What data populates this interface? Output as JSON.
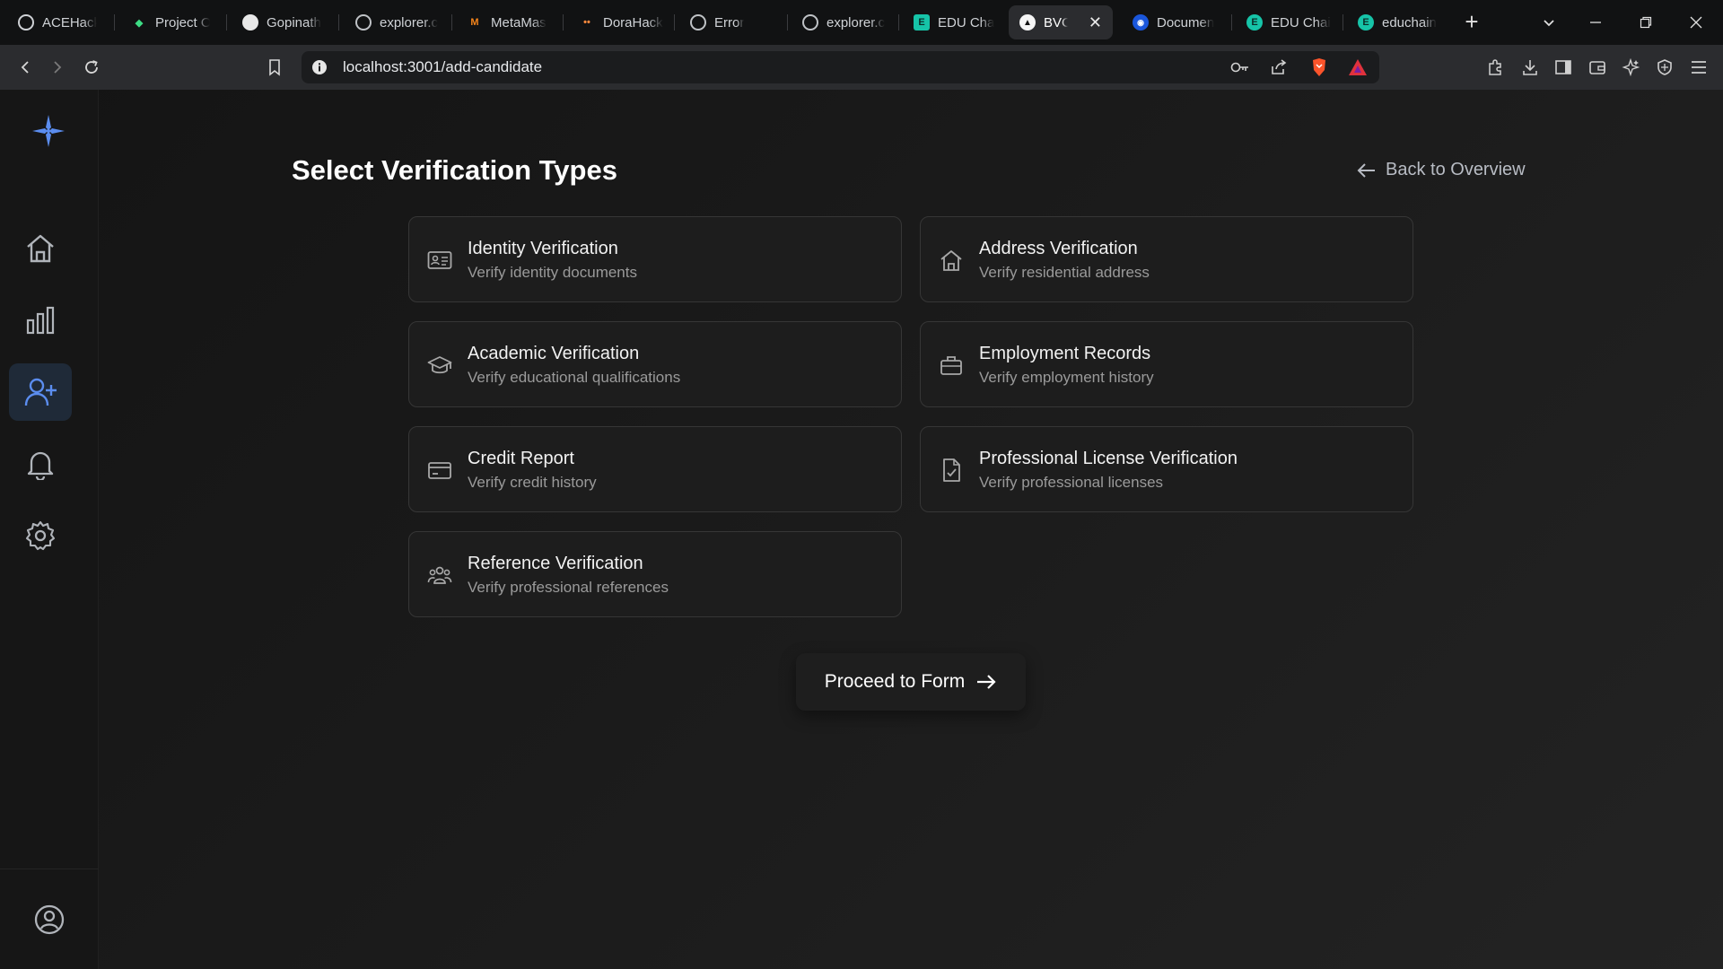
{
  "browser": {
    "tabs": [
      {
        "label": "ACEHack",
        "favicon": "circle-logo-icon"
      },
      {
        "label": "Project O",
        "favicon": "leaf-icon"
      },
      {
        "label": "Gopinath",
        "favicon": "github-icon"
      },
      {
        "label": "explorer.c",
        "favicon": "globe-icon"
      },
      {
        "label": "MetaMas",
        "favicon": "metamask-icon"
      },
      {
        "label": "DoraHack",
        "favicon": "dorahacks-icon"
      },
      {
        "label": "Error",
        "favicon": "globe-icon"
      },
      {
        "label": "explorer.c",
        "favicon": "globe-icon"
      },
      {
        "label": "EDU Cha",
        "favicon": "edu-icon"
      },
      {
        "label": "BVC",
        "favicon": "triangle-icon"
      },
      {
        "label": "Documen",
        "favicon": "doc-icon"
      },
      {
        "label": "EDU Chai",
        "favicon": "edu-circle-icon"
      },
      {
        "label": "educhain",
        "favicon": "edu-circle-icon"
      }
    ],
    "active_tab_index": 9,
    "url": "localhost:3001/add-candidate",
    "colors": {
      "brave": "#fb542b",
      "alert": "#e0323d",
      "accent": "#5b8def"
    }
  },
  "sidebar": {
    "items": [
      {
        "name": "home",
        "icon": "home-icon"
      },
      {
        "name": "analytics",
        "icon": "bar-chart-icon"
      },
      {
        "name": "add-candidate",
        "icon": "user-plus-icon",
        "active": true
      },
      {
        "name": "notifications",
        "icon": "bell-icon"
      },
      {
        "name": "settings",
        "icon": "gear-icon"
      }
    ],
    "profile_icon": "user-circle-icon",
    "logo_icon": "sparkle-logo-icon"
  },
  "main": {
    "title": "Select Verification Types",
    "back_label": "Back to Overview",
    "cards": [
      {
        "title": "Identity Verification",
        "subtitle": "Verify identity documents",
        "icon": "id-card-icon"
      },
      {
        "title": "Address Verification",
        "subtitle": "Verify residential address",
        "icon": "house-icon"
      },
      {
        "title": "Academic Verification",
        "subtitle": "Verify educational qualifications",
        "icon": "graduation-cap-icon"
      },
      {
        "title": "Employment Records",
        "subtitle": "Verify employment history",
        "icon": "briefcase-icon"
      },
      {
        "title": "Credit Report",
        "subtitle": "Verify credit history",
        "icon": "credit-card-icon"
      },
      {
        "title": "Professional License Verification",
        "subtitle": "Verify professional licenses",
        "icon": "document-check-icon"
      },
      {
        "title": "Reference Verification",
        "subtitle": "Verify professional references",
        "icon": "users-icon"
      }
    ],
    "proceed_label": "Proceed to Form"
  }
}
